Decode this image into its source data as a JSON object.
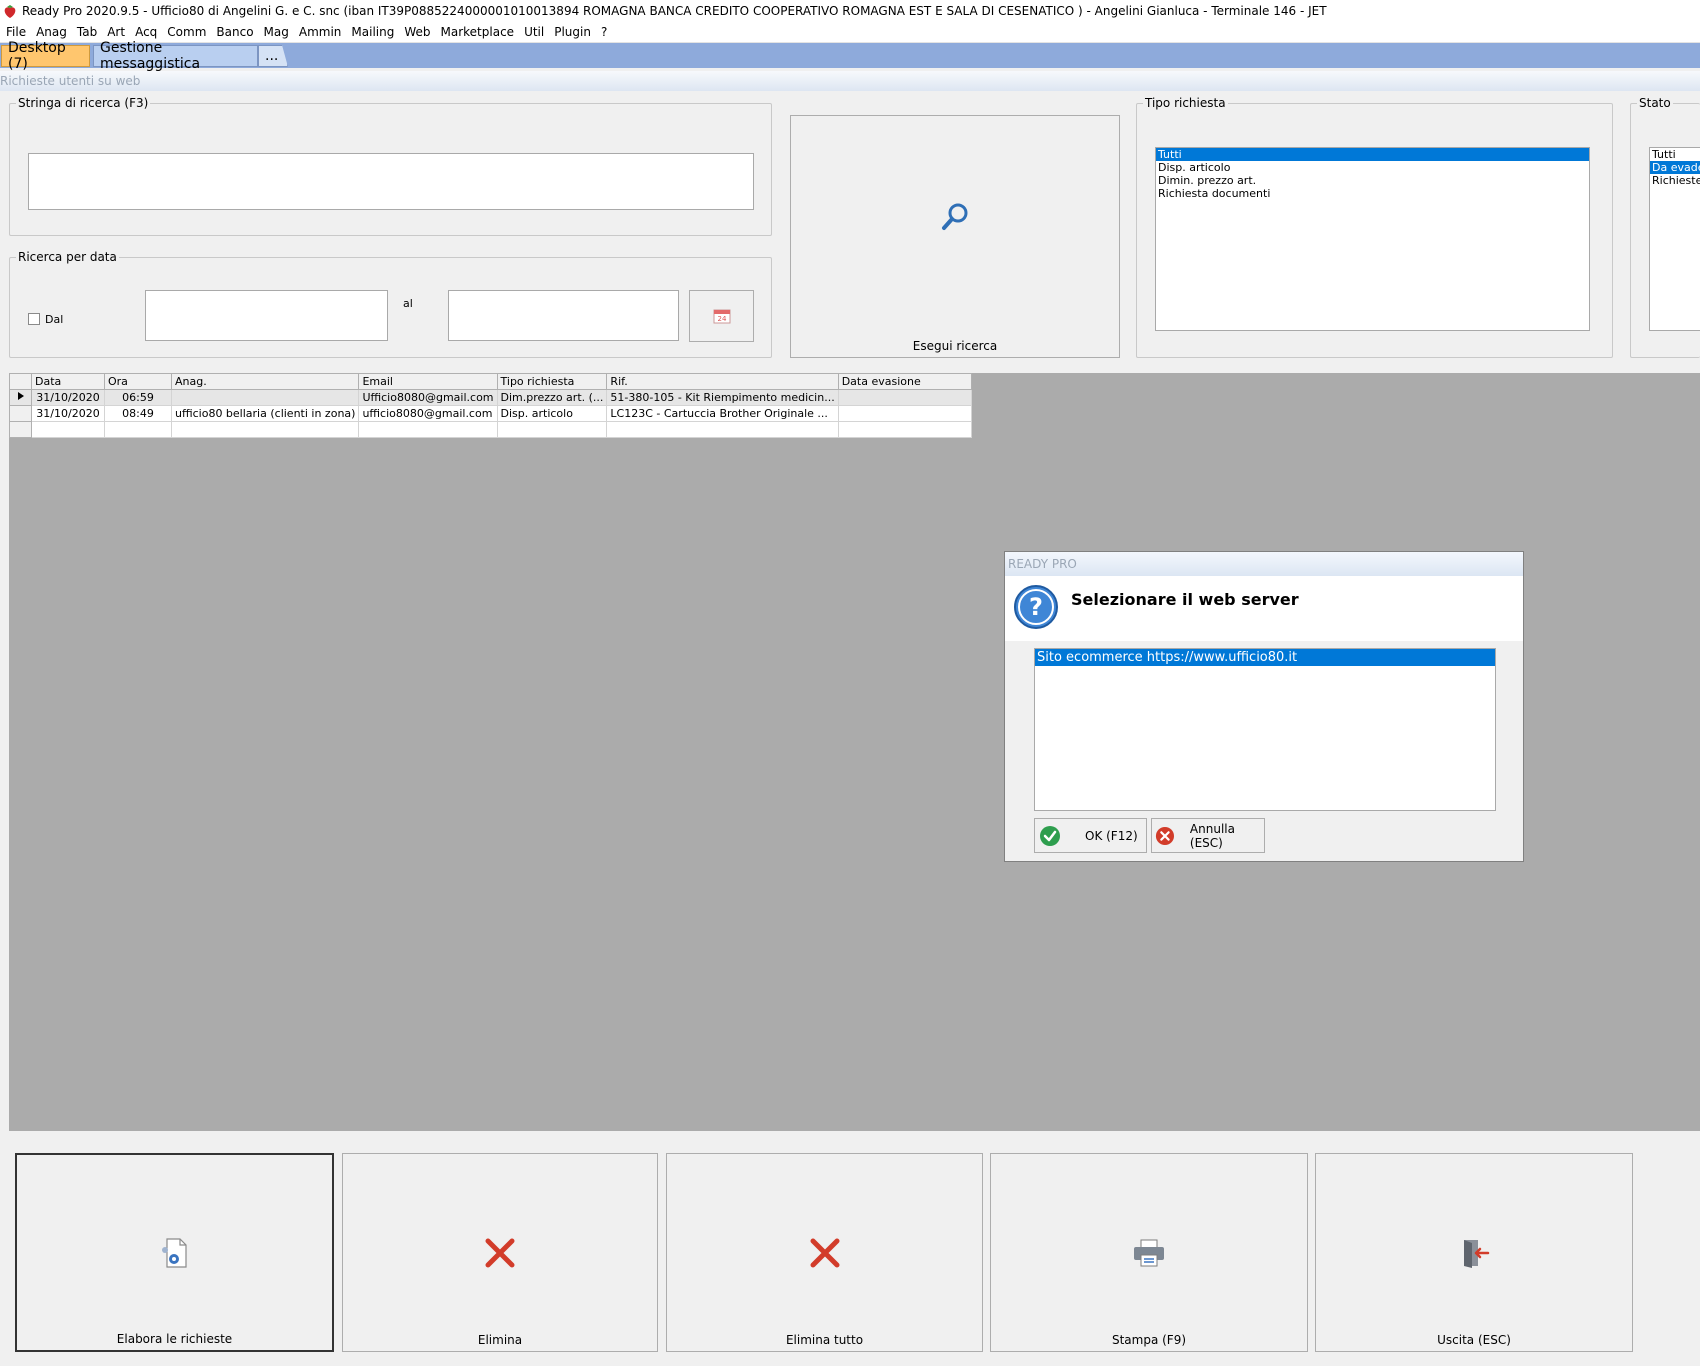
{
  "window": {
    "title": "Ready Pro 2020.9.5 - Ufficio80 di Angelini G. e C. snc (iban IT39P0885224000001010013894  ROMAGNA BANCA CREDITO COOPERATIVO ROMAGNA EST E SALA DI CESENATICO ) - Angelini Gianluca - Terminale 146 - JET"
  },
  "menu": [
    "File",
    "Anag",
    "Tab",
    "Art",
    "Acq",
    "Comm",
    "Banco",
    "Mag",
    "Ammin",
    "Mailing",
    "Web",
    "Marketplace",
    "Util",
    "Plugin",
    "?"
  ],
  "tabs": {
    "desktop": "Desktop (7)",
    "messaging": "Gestione messaggistica",
    "more": "..."
  },
  "subheader": "Richieste utenti su web",
  "search": {
    "legend": "Stringa di ricerca (F3)",
    "value": ""
  },
  "date_search": {
    "legend": "Ricerca per data",
    "from_label": "Dal",
    "to_label": "al",
    "from_value": "",
    "to_value": "",
    "from_checked": false,
    "calendar_text": "24"
  },
  "search_button": {
    "label": "Esegui ricerca"
  },
  "request_type": {
    "legend": "Tipo richiesta",
    "items": [
      "Tutti",
      "Disp. articolo",
      "Dimin. prezzo art.",
      "Richiesta documenti"
    ],
    "selected_index": 0
  },
  "status": {
    "legend": "Stato",
    "items": [
      "Tutti",
      "Da evadere",
      "Richieste evase"
    ],
    "selected_index": 1
  },
  "grid": {
    "columns": [
      "Data",
      "Ora",
      "Anag.",
      "Email",
      "Tipo richiesta",
      "Rif.",
      "Data evasione"
    ],
    "rows": [
      [
        "31/10/2020",
        "06:59",
        "",
        "Ufficio8080@gmail.com",
        "Dim.prezzo art. (...",
        "51-380-105 - Kit Riempimento medicin...",
        ""
      ],
      [
        "31/10/2020",
        "08:49",
        "ufficio80 bellaria (clienti in zona)",
        "ufficio8080@gmail.com",
        "Disp. articolo",
        "LC123C - Cartuccia Brother Originale ...",
        ""
      ]
    ]
  },
  "dialog": {
    "title": "READY PRO",
    "heading": "Selezionare il web server",
    "items": [
      "Sito ecommerce https://www.ufficio80.it"
    ],
    "selected_index": 0,
    "ok_label": "OK (F12)",
    "cancel_label": "Annulla (ESC)"
  },
  "bottom_buttons": {
    "process": "Elabora le richieste",
    "delete": "Elimina",
    "delete_all": "Elimina tutto",
    "print": "Stampa (F9)",
    "exit": "Uscita (ESC)"
  },
  "colors": {
    "selection": "#0078d7",
    "tabbar": "#8eaadb",
    "active_tab": "#ffc66e",
    "grid_background": "#ababab",
    "delete_red": "#d23c2a",
    "ok_green": "#2e9e4e"
  }
}
